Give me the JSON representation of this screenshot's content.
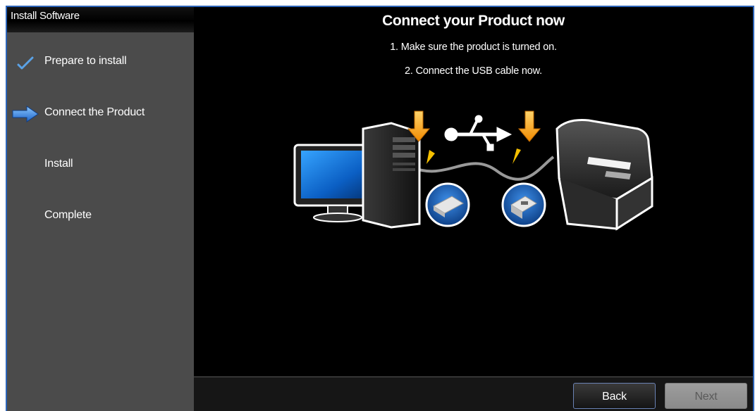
{
  "sidebar": {
    "title": "Install Software",
    "steps": [
      {
        "label": "Prepare to install",
        "icon": "checkmark-icon",
        "state": "done"
      },
      {
        "label": "Connect the Product",
        "icon": "arrow-right-icon",
        "state": "current"
      },
      {
        "label": "Install",
        "icon": "",
        "state": "pending"
      },
      {
        "label": "Complete",
        "icon": "",
        "state": "pending"
      }
    ]
  },
  "main": {
    "heading": "Connect your Product now",
    "instructions": [
      "1. Make sure the product is turned on.",
      "2. Connect the USB cable now."
    ]
  },
  "footer": {
    "back_label": "Back",
    "next_label": "Next",
    "next_enabled": false
  },
  "colors": {
    "accent": "#2c64b8",
    "arrow_orange": "#f5a623",
    "usb_blue": "#1e6fd1"
  }
}
